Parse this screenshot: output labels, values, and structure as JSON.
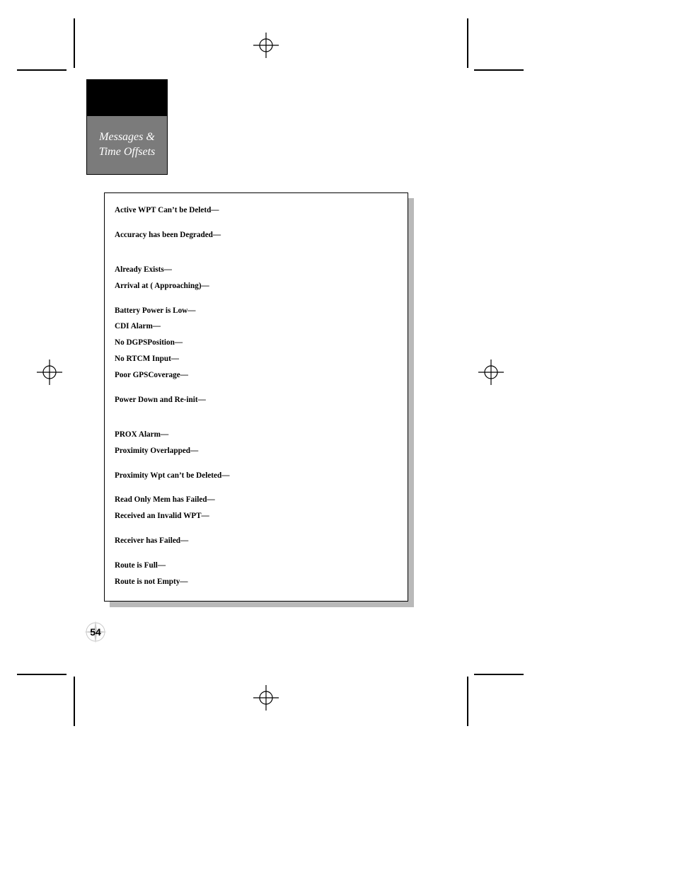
{
  "sidebar": {
    "line1": "Messages &",
    "line2": "Time Offsets"
  },
  "messages": {
    "m0": "Active WPT Can’t be Deletd—",
    "m1": "Accuracy has been Degraded—",
    "m2": "Already Exists—",
    "m3": "Arrival at (   Approaching)—",
    "m4": "Battery Power is Low—",
    "m5": "CDI Alarm—",
    "m6": "No  DGPSPosition—",
    "m7": "No RTCM Input—",
    "m8": "Poor  GPSCoverage—",
    "m9": "Power Down and Re-init—",
    "m10": "PROX Alarm—",
    "m11": "Proximity Overlapped—",
    "m12": "Proximity Wpt can’t be Deleted—",
    "m13": "Read Only Mem has Failed—",
    "m14": "Received an Invalid WPT—",
    "m15": "Receiver has Failed—",
    "m16": "Route is Full—",
    "m17": "Route is not Empty—"
  },
  "page_number": "54"
}
